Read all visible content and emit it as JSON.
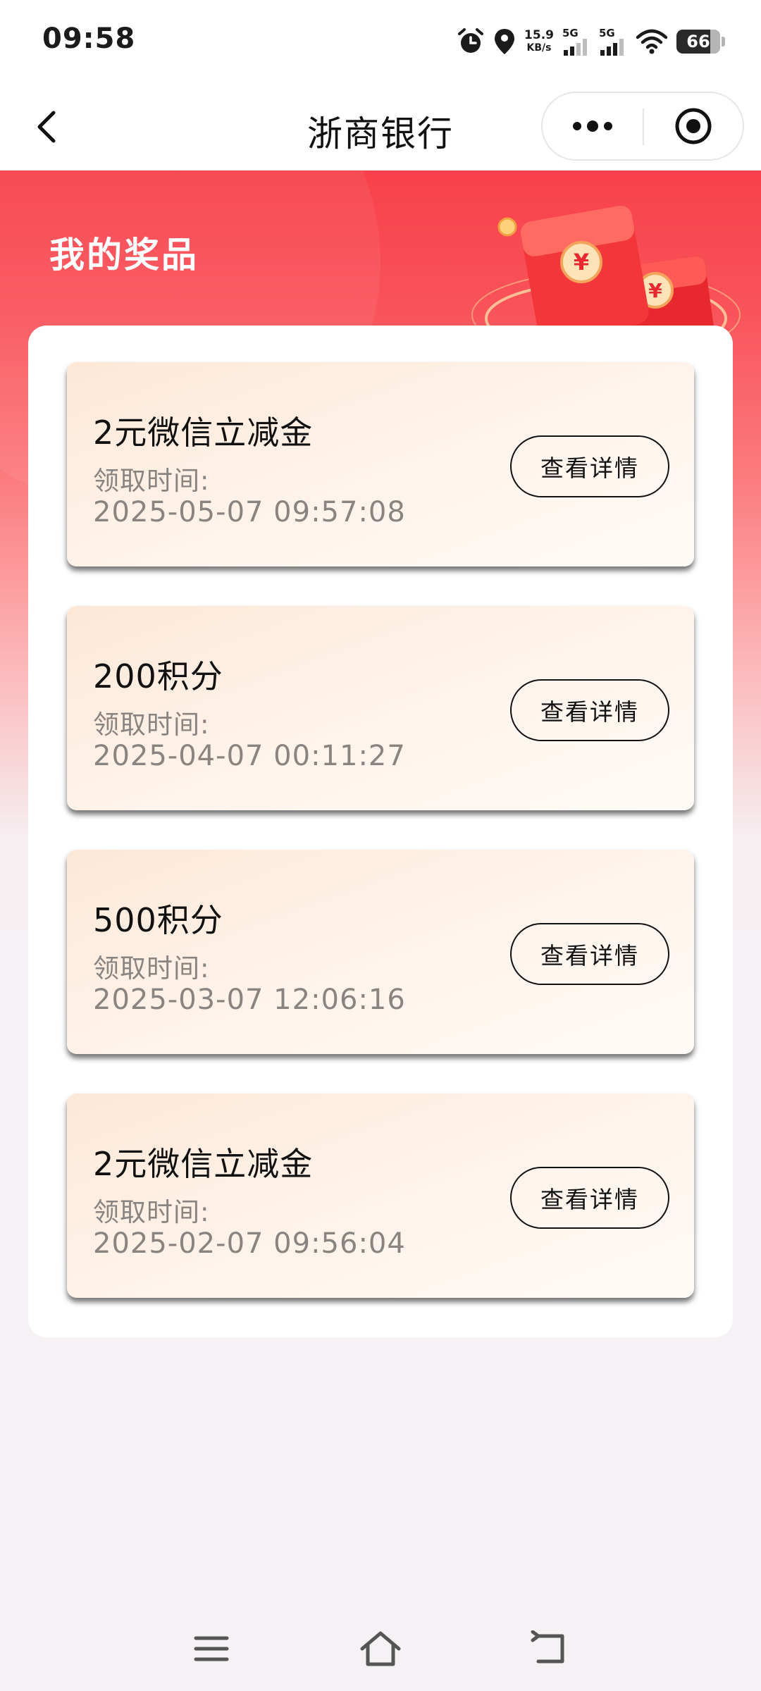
{
  "status_bar": {
    "time": "09:58",
    "net_speed_value": "15.9",
    "net_speed_unit": "KB/s",
    "sim1_label": "5G",
    "sim2_label": "5G",
    "battery_level": "66",
    "icons": [
      "alarm-icon",
      "location-icon",
      "signal-icon",
      "signal-icon",
      "wifi-icon",
      "battery-icon"
    ]
  },
  "nav": {
    "title": "浙商银行",
    "back_icon": "chevron-left-icon",
    "more_icon": "more-dots-icon",
    "close_icon": "target-circle-icon"
  },
  "hero": {
    "title": "我的奖品",
    "illustration": "red-envelope-illustration"
  },
  "prizes": [
    {
      "name": "2元微信立减金",
      "time_label": "领取时间:",
      "time": "2025-05-07 09:57:08",
      "action": "查看详情"
    },
    {
      "name": "200积分",
      "time_label": "领取时间:",
      "time": "2025-04-07 00:11:27",
      "action": "查看详情"
    },
    {
      "name": "500积分",
      "time_label": "领取时间:",
      "time": "2025-03-07 12:06:16",
      "action": "查看详情"
    },
    {
      "name": "2元微信立减金",
      "time_label": "领取时间:",
      "time": "2025-02-07 09:56:04",
      "action": "查看详情"
    }
  ],
  "system_nav": [
    "menu-icon",
    "home-icon",
    "back-icon"
  ],
  "colors": {
    "brand_red": "#f8404a",
    "card_bg": "#fde8d7",
    "muted_text": "#8a8480"
  }
}
